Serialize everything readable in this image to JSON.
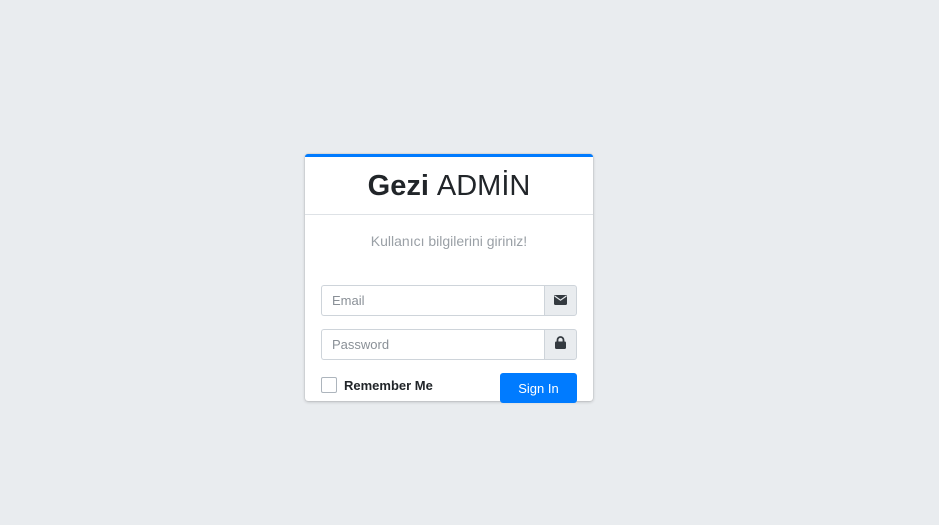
{
  "brand": {
    "bold": "Gezi",
    "light": "ADMİN"
  },
  "login": {
    "subtitle": "Kullanıcı bilgilerini giriniz!",
    "email_placeholder": "Email",
    "email_value": "",
    "email_icon": "envelope-icon",
    "password_placeholder": "Password",
    "password_value": "",
    "password_icon": "lock-icon",
    "remember_label": "Remember Me",
    "remember_checked": false,
    "signin_label": "Sign In"
  },
  "colors": {
    "accent": "#007bff",
    "background": "#e9ecef"
  }
}
